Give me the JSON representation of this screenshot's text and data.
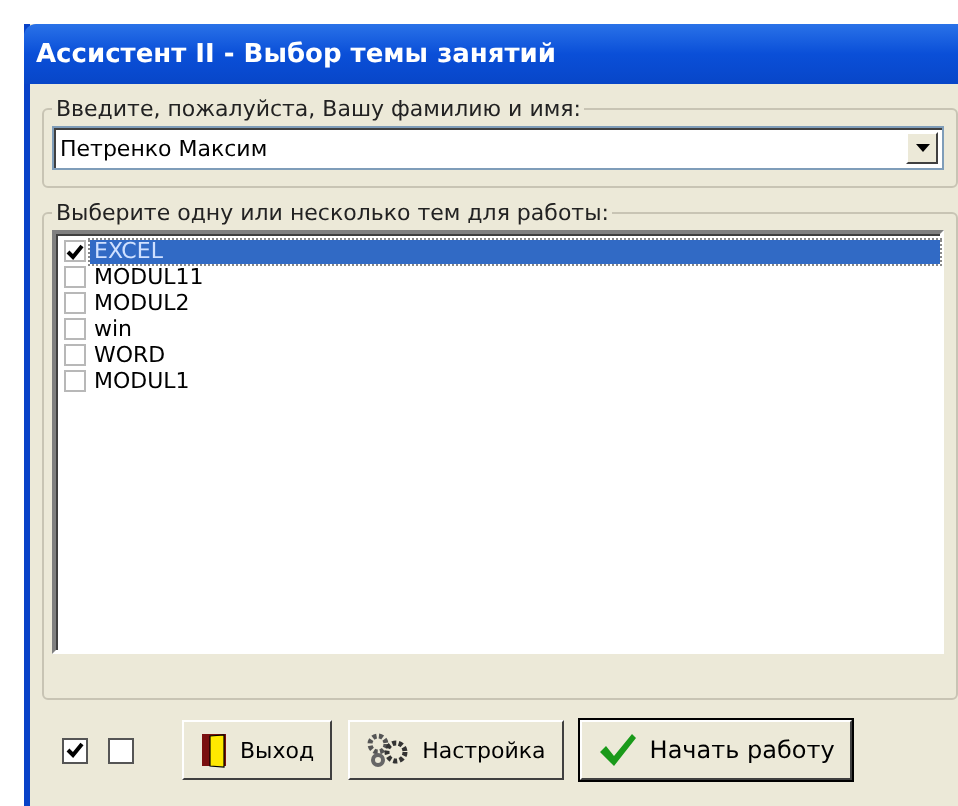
{
  "window": {
    "title": "Ассистент II - Выбор темы занятий"
  },
  "name_group": {
    "label": "Введите, пожалуйста, Вашу фамилию и имя:",
    "value": "Петренко Максим"
  },
  "topics_group": {
    "label": "Выберите одну или несколько тем для работы:",
    "items": [
      {
        "label": "EXCEL",
        "checked": true,
        "selected": true
      },
      {
        "label": "MODUL11",
        "checked": false,
        "selected": false
      },
      {
        "label": "MODUL2",
        "checked": false,
        "selected": false
      },
      {
        "label": "win",
        "checked": false,
        "selected": false
      },
      {
        "label": "WORD",
        "checked": false,
        "selected": false
      },
      {
        "label": "MODUL1",
        "checked": false,
        "selected": false
      }
    ]
  },
  "options": [
    {
      "checked": true
    },
    {
      "checked": false
    }
  ],
  "buttons": [
    {
      "label": "Выход",
      "kind": "exit",
      "default": false
    },
    {
      "label": "Настройка",
      "kind": "settings",
      "default": false
    },
    {
      "label": "Начать работу",
      "kind": "start",
      "default": true
    }
  ]
}
